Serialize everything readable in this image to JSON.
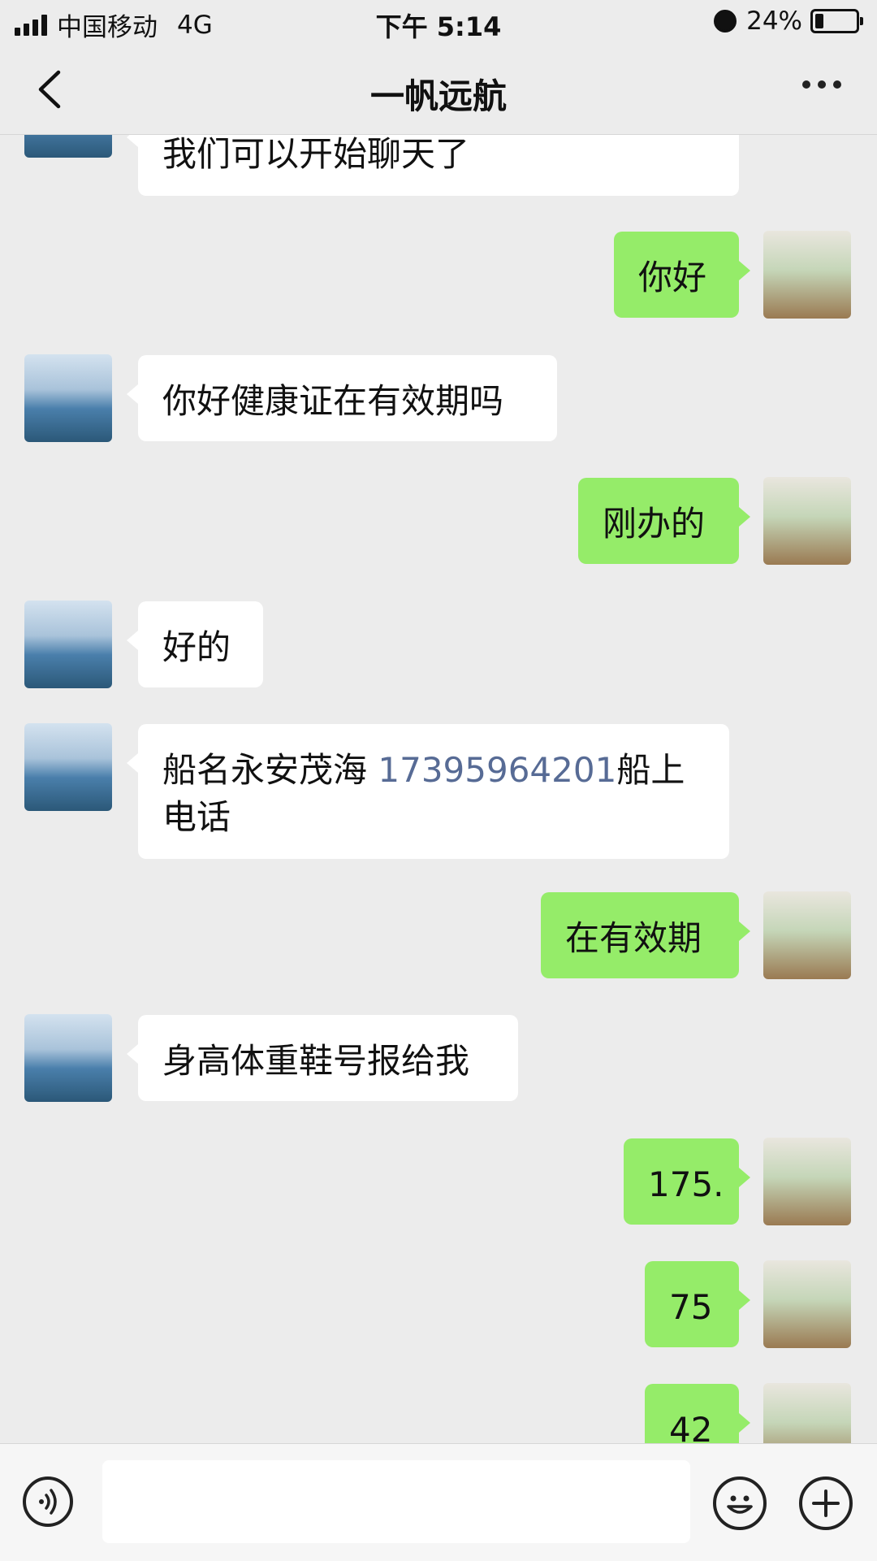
{
  "status_bar": {
    "carrier": "中国移动",
    "network": "4G",
    "time": "下午 5:14",
    "battery": "24%",
    "battery_level": 0.24
  },
  "header": {
    "title": "一帆远航",
    "back_icon": "chevron-left-icon",
    "more_icon": "more-dots-icon"
  },
  "messages": [
    {
      "from": "other",
      "text": "我们可以开始聊天了"
    },
    {
      "from": "me",
      "text": "你好"
    },
    {
      "from": "other",
      "text": "你好健康证在有效期吗"
    },
    {
      "from": "me",
      "text": "刚办的"
    },
    {
      "from": "other",
      "text": "好的"
    },
    {
      "from": "other",
      "text_before": "船名永安茂海",
      "phone": "17395964201",
      "text_after": "船上电话"
    },
    {
      "from": "me",
      "text": "在有效期"
    },
    {
      "from": "other",
      "text": "身高体重鞋号报给我"
    },
    {
      "from": "me",
      "text": "175."
    },
    {
      "from": "me",
      "text": "75"
    },
    {
      "from": "me",
      "text": "42"
    }
  ],
  "input_bar": {
    "voice_icon": "voice-icon",
    "emoji_icon": "emoji-icon",
    "plus_icon": "plus-icon",
    "placeholder": ""
  },
  "colors": {
    "background": "#ececec",
    "outgoing_bubble": "#95ec69",
    "incoming_bubble": "#ffffff",
    "link": "#576b95"
  }
}
